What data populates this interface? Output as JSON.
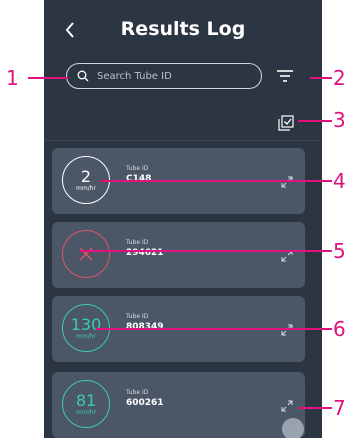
{
  "header": {
    "title": "Results Log",
    "back_icon": "chevron-left-icon"
  },
  "search": {
    "placeholder": "Search Tube ID",
    "value": ""
  },
  "toolbar": {
    "filter_icon": "filter-icon",
    "select_icon": "multi-select-icon"
  },
  "results": [
    {
      "value": "2",
      "unit": "mm/hr",
      "status": "normal",
      "ring_color": "#ffffff",
      "tube_label": "Tube ID",
      "tube_id": "C148"
    },
    {
      "value": "",
      "unit": "",
      "status": "error",
      "ring_color": "#d9566a",
      "tube_label": "Tube ID",
      "tube_id": "294621"
    },
    {
      "value": "130",
      "unit": "mm/hr",
      "status": "normal",
      "ring_color": "#3ec9b4",
      "tube_label": "Tube ID",
      "tube_id": "808349"
    },
    {
      "value": "81",
      "unit": "mm/hr",
      "status": "normal",
      "ring_color": "#3ec9b4",
      "tube_label": "Tube ID",
      "tube_id": "600261"
    }
  ],
  "annotations": [
    "1",
    "2",
    "3",
    "4",
    "5",
    "6",
    "7"
  ],
  "colors": {
    "background": "#2c3643",
    "card": "#4b5767",
    "annotation": "#e0127e",
    "teal": "#3ec9b4",
    "error": "#d9566a"
  }
}
